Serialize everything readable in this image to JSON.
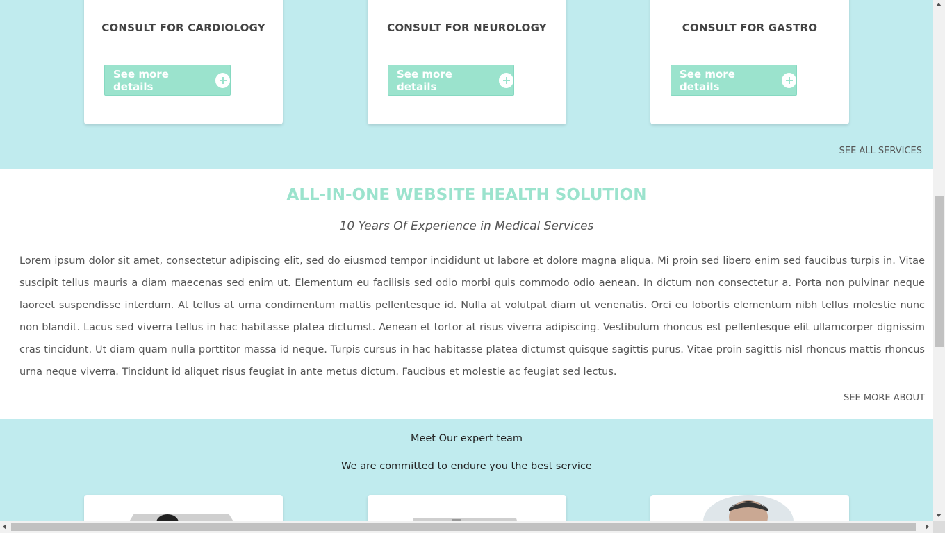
{
  "services": {
    "cards": [
      {
        "title": "CONSULT FOR CARDIOLOGY",
        "button_label": "See more details"
      },
      {
        "title": "CONSULT FOR NEUROLOGY",
        "button_label": "See more details"
      },
      {
        "title": "CONSULT FOR GASTRO",
        "button_label": "See more details"
      }
    ],
    "see_all_label": "SEE ALL SERVICES"
  },
  "about": {
    "title": "ALL-IN-ONE WEBSITE HEALTH SOLUTION",
    "subtitle": "10 Years Of Experience in Medical Services",
    "body": "Lorem ipsum dolor sit amet, consectetur adipiscing elit, sed do eiusmod tempor incididunt ut labore et dolore magna aliqua. Mi proin sed libero enim sed faucibus turpis in. Vitae suscipit tellus mauris a diam maecenas sed enim ut. Elementum eu facilisis sed odio morbi quis commodo odio aenean. In dictum non consectetur a. Porta non pulvinar neque laoreet suspendisse interdum. At tellus at urna condimentum mattis pellentesque id. Nulla at volutpat diam ut venenatis. Orci eu lobortis elementum nibh tellus molestie nunc non blandit. Lacus sed viverra tellus in hac habitasse platea dictumst. Aenean et tortor at risus viverra adipiscing. Vestibulum rhoncus est pellentesque elit ullamcorper dignissim cras tincidunt. Ut diam quam nulla porttitor massa id neque. Turpis cursus in hac habitasse platea dictumst quisque sagittis purus. Vitae proin sagittis nisl rhoncus mattis rhoncus urna neque viverra. Tincidunt id aliquet risus feugiat in ante metus dictum. Faucibus et molestie ac feugiat sed lectus.",
    "see_more_label": "SEE MORE ABOUT"
  },
  "team": {
    "title": "Meet Our expert team",
    "subtitle": "We are committed to endure you the best service"
  },
  "colors": {
    "band_bg": "#c0ebee",
    "accent": "#9be3cd",
    "text": "#555555"
  },
  "icons": {
    "button_icon": "plus-circle-icon"
  }
}
